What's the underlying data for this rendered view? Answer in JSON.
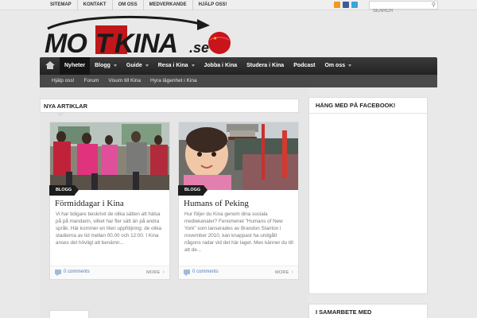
{
  "topbar": {
    "links": [
      "SITEMAP",
      "KONTAKT",
      "OM OSS",
      "MEDVERKANDE",
      "HJÄLP OSS!"
    ],
    "search_placeholder": "SEARCH"
  },
  "logo": {
    "text_main": "MOTKINA",
    "text_suffix": ".se"
  },
  "nav": {
    "items": [
      {
        "label": "Nyheter",
        "active": true,
        "dropdown": false
      },
      {
        "label": "Blogg",
        "active": false,
        "dropdown": true
      },
      {
        "label": "Guide",
        "active": false,
        "dropdown": true
      },
      {
        "label": "Resa i Kina",
        "active": false,
        "dropdown": true
      },
      {
        "label": "Jobba i Kina",
        "active": false,
        "dropdown": false
      },
      {
        "label": "Studera i Kina",
        "active": false,
        "dropdown": false
      },
      {
        "label": "Podcast",
        "active": false,
        "dropdown": false
      },
      {
        "label": "Om oss",
        "active": false,
        "dropdown": true
      }
    ],
    "sub_items": [
      "Hjälp oss!",
      "Forum",
      "Visum till Kina",
      "Hyra lägenhet i Kina"
    ]
  },
  "section": {
    "title": "NYA ARTIKLAR"
  },
  "articles": [
    {
      "category": "BLOGG",
      "title": "Förmiddagar i Kina",
      "excerpt": "Vi har tidigare beskrivit de olika sätten att hälsa på på mandarin, vilket har fler sätt än på andra språk. Här kommer en liten uppföljning: de olika stadierna av tid mellan 00.00 och 12:00.   I Kina anses det hövligt att benämn...",
      "comments": "0 comments",
      "more": "MORE"
    },
    {
      "category": "BLOGG",
      "title": "Humans of Peking",
      "excerpt": "Hur följer du Kina genom dina sociala mediekanaler? Fenomenet \"Humans of New York\" som lanserades av Brandon Stanton i november 2010, kan knappast ha undgått någons radar vid det här laget. Men känner du till att de...",
      "comments": "0 comments",
      "more": "MORE"
    }
  ],
  "sidebar": {
    "widget1_title": "HÄNG MED PÅ FACEBOOK!",
    "widget2_title": "I SAMARBETE MED"
  },
  "colors": {
    "accent_red": "#c0171b",
    "nav_dark": "#2a2a2a",
    "link_blue": "#4f7fb8"
  }
}
